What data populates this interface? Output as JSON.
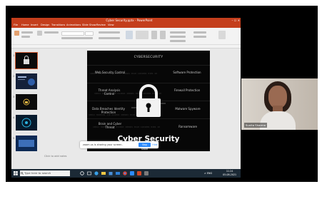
{
  "ppt": {
    "title": "Cyber Security.pptx - PowerPoint",
    "window_controls": "–  ☐  ✕",
    "tabs": [
      "File",
      "Home",
      "Insert",
      "Design",
      "Transitions",
      "Animations",
      "Slide Show",
      "Review",
      "View"
    ],
    "notes_placeholder": "Click to add notes",
    "thumbnail_numbers": [
      "1",
      "2",
      "3",
      "4",
      "5"
    ]
  },
  "slide": {
    "heading": "CYBERSECURITY",
    "title": "Cyber Security",
    "keywords": [
      "Web Security Control",
      "Software Protection",
      "Threat Analysis Control",
      "Firewall Protection",
      "Data Breaches Identity Protection",
      "Malware Spyware",
      "Brain and Cyber Threat",
      "Ransomware"
    ],
    "matrix_text": "10011 0100101 110 011010 100101 0110 1101001 0101 10"
  },
  "share_bar": {
    "text": "zoom.us is sharing your screen.",
    "share_button": "Stop Share",
    "hide_button": "Hide"
  },
  "taskbar": {
    "search_placeholder": "Type here to search",
    "tray": "∧  ENG",
    "time": "11:24",
    "date": "05-08-2021"
  },
  "participant": {
    "name": "Sunita Sharma"
  },
  "colors": {
    "ppt_accent": "#c43e1c",
    "zoom_blue": "#2d8cff",
    "taskbar": "#1c2a36"
  }
}
